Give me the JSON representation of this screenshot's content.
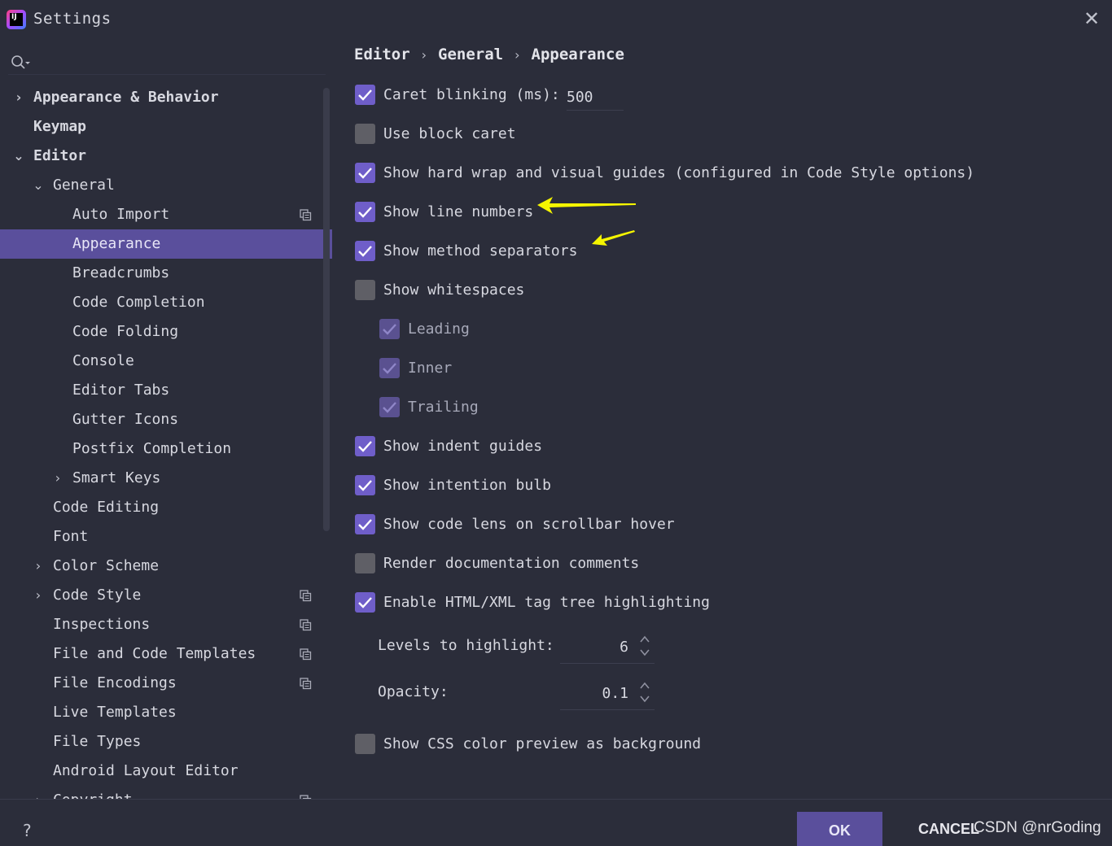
{
  "window": {
    "title": "Settings",
    "icon_text": "IJ"
  },
  "search": {
    "placeholder": ""
  },
  "tree": [
    {
      "label": "Appearance & Behavior",
      "chevron": "›",
      "bold": true
    },
    {
      "label": "Keymap",
      "chevron": "",
      "bold": true
    },
    {
      "label": "Editor",
      "chevron": "⌄",
      "bold": true
    },
    {
      "label": "General",
      "chevron": "⌄"
    },
    {
      "label": "Auto Import",
      "copy": true
    },
    {
      "label": "Appearance",
      "selected": true
    },
    {
      "label": "Breadcrumbs"
    },
    {
      "label": "Code Completion"
    },
    {
      "label": "Code Folding"
    },
    {
      "label": "Console"
    },
    {
      "label": "Editor Tabs"
    },
    {
      "label": "Gutter Icons"
    },
    {
      "label": "Postfix Completion"
    },
    {
      "label": "Smart Keys",
      "chevron": "›"
    },
    {
      "label": "Code Editing"
    },
    {
      "label": "Font"
    },
    {
      "label": "Color Scheme",
      "chevron": "›"
    },
    {
      "label": "Code Style",
      "chevron": "›",
      "copy": true
    },
    {
      "label": "Inspections",
      "copy": true
    },
    {
      "label": "File and Code Templates",
      "copy": true
    },
    {
      "label": "File Encodings",
      "copy": true
    },
    {
      "label": "Live Templates"
    },
    {
      "label": "File Types"
    },
    {
      "label": "Android Layout Editor"
    },
    {
      "label": "Copyright",
      "chevron": "›",
      "copy": true
    }
  ],
  "breadcrumb": {
    "part1": "Editor",
    "part2": "General",
    "part3": "Appearance",
    "sep": "›"
  },
  "options": [
    {
      "label": "Caret blinking (ms):",
      "checked": true
    },
    {
      "label": "Use block caret",
      "checked": false
    },
    {
      "label": "Show hard wrap and visual guides (configured in Code Style options)",
      "checked": true
    },
    {
      "label": "Show line numbers",
      "checked": true
    },
    {
      "label": "Show method separators",
      "checked": true
    },
    {
      "label": "Show whitespaces",
      "checked": false
    },
    {
      "label": "Leading",
      "checked": true,
      "disabled": true
    },
    {
      "label": "Inner",
      "checked": true,
      "disabled": true
    },
    {
      "label": "Trailing",
      "checked": true,
      "disabled": true
    },
    {
      "label": "Show indent guides",
      "checked": true
    },
    {
      "label": "Show intention bulb",
      "checked": true
    },
    {
      "label": "Show code lens on scrollbar hover",
      "checked": true
    },
    {
      "label": "Render documentation comments",
      "checked": false
    },
    {
      "label": "Enable HTML/XML tag tree highlighting",
      "checked": true
    },
    {
      "label": "Show CSS color preview as background",
      "checked": false
    }
  ],
  "caret_blink_value": "500",
  "levels": {
    "label": "Levels to highlight:",
    "value": "6"
  },
  "opacity": {
    "label": "Opacity:",
    "value": "0.1"
  },
  "footer": {
    "help": "?",
    "ok": "OK",
    "cancel": "CANCEL",
    "watermark": "CSDN @nrGoding"
  },
  "colors": {
    "accent": "#6f5ec9",
    "selection": "#5a4f9c",
    "background": "#2b2d3a",
    "arrow": "#f5f500"
  }
}
